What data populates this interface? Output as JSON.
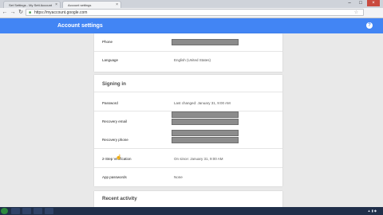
{
  "browser": {
    "tabs": [
      {
        "label": "Set Settings - My Sett Account"
      },
      {
        "label": "Account settings"
      }
    ],
    "url": "https://myaccount.google.com"
  },
  "app": {
    "title": "Account settings"
  },
  "personal_card": {
    "rows": [
      {
        "key": "Phone",
        "value": ""
      },
      {
        "key": "Language",
        "value": "English (United States)"
      }
    ]
  },
  "signing_in": {
    "heading": "Signing in",
    "rows": [
      {
        "key": "Password",
        "value": "Last changed: January 31, 9:00 AM"
      },
      {
        "key": "Recovery email",
        "value": ""
      },
      {
        "key": "Recovery phone",
        "value": ""
      },
      {
        "key": "2-Step Verification",
        "value": "On since: January 31, 9:00 AM"
      },
      {
        "key": "App passwords",
        "value": "None"
      }
    ]
  },
  "recent_activity": {
    "heading": "Recent activity"
  },
  "colors": {
    "brand_blue": "#4285f4",
    "redaction_gray": "#8c8c8c",
    "window_close": "#c94a3f"
  },
  "icons": [
    "back-icon",
    "forward-icon",
    "refresh-icon",
    "lock-icon",
    "star-icon",
    "help-icon",
    "cursor-icon"
  ]
}
